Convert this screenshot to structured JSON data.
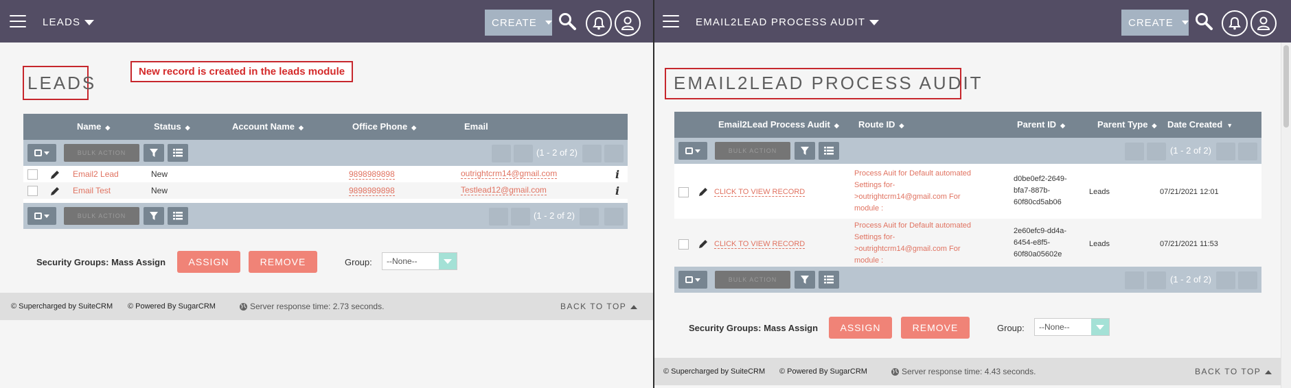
{
  "left": {
    "module_menu": "LEADS",
    "create_label": "CREATE",
    "title": "LEADS",
    "annotation": "New record is created in the leads module",
    "columns": [
      "Name",
      "Status",
      "Account Name",
      "Office Phone",
      "Email"
    ],
    "bulk_action": "BULK ACTION",
    "page_count": "(1 - 2 of 2)",
    "rows": [
      {
        "name": "Email2 Lead",
        "status": "New",
        "phone": "9898989898",
        "email": "outrightcrm14@gmail.com"
      },
      {
        "name": "Email Test",
        "status": "New",
        "phone": "9898989898",
        "email": "Testlead12@gmail.com"
      }
    ],
    "mass_assign_label": "Security Groups: Mass Assign",
    "assign_label": "ASSIGN",
    "remove_label": "REMOVE",
    "group_label": "Group:",
    "group_value": "--None--",
    "footer": {
      "suitecrm": "© Supercharged by SuiteCRM",
      "sugarcrm": "© Powered By SugarCRM",
      "server_time": "Server response time: 2.73 seconds.",
      "back_to_top": "BACK TO TOP"
    }
  },
  "right": {
    "module_menu": "EMAIL2LEAD PROCESS AUDIT",
    "create_label": "CREATE",
    "title": "EMAIL2LEAD PROCESS AUDIT",
    "columns": [
      "Email2Lead Process Audit",
      "Route ID",
      "Parent ID",
      "Parent Type",
      "Date Created"
    ],
    "bulk_action": "BULK ACTION",
    "page_count": "(1 - 2 of 2)",
    "rows": [
      {
        "link": "CLICK TO VIEW RECORD",
        "route_lines": [
          "Process Auit for Default automated",
          "Settings for-",
          ">outrightcrm14@gmail.com For",
          "module :"
        ],
        "parent_id_lines": [
          "d0be0ef2-2649-",
          "bfa7-887b-",
          "60f80cd5ab06"
        ],
        "parent_type": "Leads",
        "date_created": "07/21/2021 12:01"
      },
      {
        "link": "CLICK TO VIEW RECORD",
        "route_lines": [
          "Process Auit for Default automated",
          "Settings for-",
          ">outrightcrm14@gmail.com For",
          "module :"
        ],
        "parent_id_lines": [
          "2e60efc9-dd4a-",
          "6454-e8f5-",
          "60f80a05602e"
        ],
        "parent_type": "Leads",
        "date_created": "07/21/2021 11:53"
      }
    ],
    "mass_assign_label": "Security Groups: Mass Assign",
    "assign_label": "ASSIGN",
    "remove_label": "REMOVE",
    "group_label": "Group:",
    "group_value": "--None--",
    "footer": {
      "suitecrm": "© Supercharged by SuiteCRM",
      "sugarcrm": "© Powered By SugarCRM",
      "server_time": "Server response time: 4.43 seconds.",
      "back_to_top": "BACK TO TOP"
    }
  },
  "colors": {
    "topbar": "#534d64",
    "table_header": "#778591",
    "action_bar": "#b9c5d0",
    "link": "#e07260",
    "button": "#f08377",
    "annotation_red": "#c6262c",
    "footer": "#dedede"
  },
  "icons": [
    "hamburger-icon",
    "caret-down-icon",
    "search-icon",
    "bell-icon",
    "user-icon",
    "filter-icon",
    "columns-icon",
    "pencil-icon",
    "info-icon",
    "globe-icon",
    "arrow-up-icon"
  ]
}
